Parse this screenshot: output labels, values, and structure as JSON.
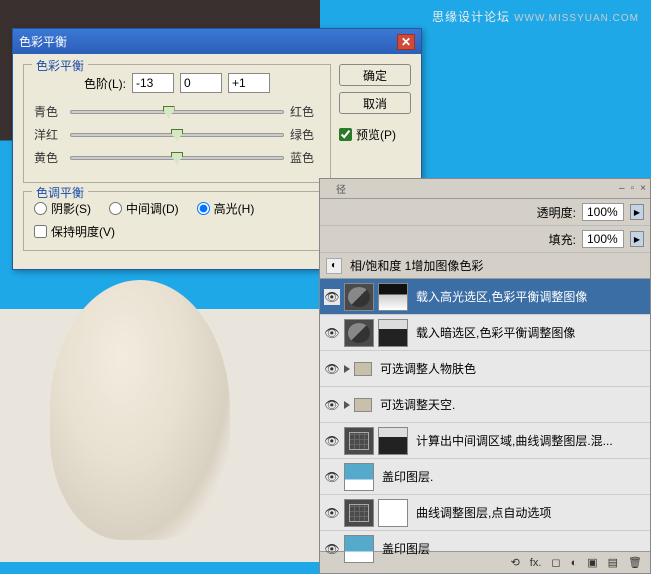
{
  "watermark": {
    "text1": "思缘设计论坛",
    "text2": "WWW.MISSYUAN.COM"
  },
  "dialog": {
    "title": "色彩平衡",
    "group1_legend": "色彩平衡",
    "levels_label": "色阶(L):",
    "levels": {
      "a": "-13",
      "b": "0",
      "c": "+1"
    },
    "sliders": [
      {
        "left": "青色",
        "right": "红色",
        "pos": 46
      },
      {
        "left": "洋红",
        "right": "绿色",
        "pos": 50
      },
      {
        "left": "黄色",
        "right": "蓝色",
        "pos": 50
      }
    ],
    "group2_legend": "色调平衡",
    "tone": {
      "shadow": "阴影(S)",
      "mid": "中间调(D)",
      "high": "高光(H)"
    },
    "preserve": "保持明度(V)",
    "buttons": {
      "ok": "确定",
      "cancel": "取消"
    },
    "preview": "预览(P)"
  },
  "layers": {
    "tab_char": "径",
    "opacity_label": "透明度:",
    "opacity_value": "100%",
    "fill_label": "填充:",
    "fill_value": "100%",
    "hue_row": "相/饱和度 1增加图像色彩",
    "items": [
      {
        "type": "adj",
        "label": "载入高光选区,色彩平衡调整图像",
        "selected": true
      },
      {
        "type": "adj2",
        "label": "载入暗选区,色彩平衡调整图像"
      },
      {
        "type": "folder",
        "label": "可选调整人物肤色"
      },
      {
        "type": "folder",
        "label": "可选调整天空."
      },
      {
        "type": "curve",
        "label": "计算出中间调区域,曲线调整图层.混..."
      },
      {
        "type": "seal",
        "label": "盖印图层."
      },
      {
        "type": "curve2",
        "label": "曲线调整图层,点自动选项"
      },
      {
        "type": "seal",
        "label": "盖印图层"
      }
    ]
  }
}
